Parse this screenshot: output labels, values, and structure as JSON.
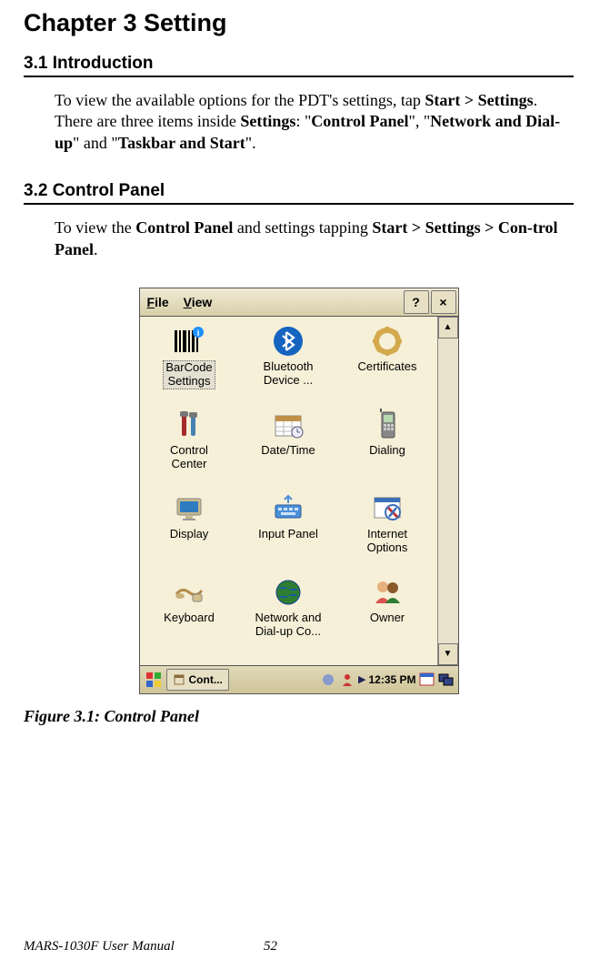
{
  "chapter": {
    "title": "Chapter 3    Setting"
  },
  "sections": [
    {
      "heading": "3.1    Introduction",
      "html": "To view the available options for the PDT's settings, tap <b>Start > Settings</b>. There are three items inside <b>Settings</b>: \"<b>Control Panel</b>\", \"<b>Network and Dial-up</b>\" and \"<b>Taskbar and Start</b>\"."
    },
    {
      "heading": "3.2    Control Panel",
      "html": "To view the <b>Control Panel</b> and settings tapping <b>Start > Settings > Con-trol Panel</b>."
    }
  ],
  "screenshot": {
    "titlebar": {
      "menu_file_u": "F",
      "menu_file_rest": "ile",
      "menu_view_u": "V",
      "menu_view_rest": "iew",
      "help": "?",
      "close": "×"
    },
    "items": [
      {
        "label": "BarCode\nSettings",
        "selected": true,
        "icon": "barcode-icon"
      },
      {
        "label": "Bluetooth\nDevice ...",
        "selected": false,
        "icon": "bluetooth-icon"
      },
      {
        "label": "Certificates",
        "selected": false,
        "icon": "gear-icon"
      },
      {
        "label": "Control\nCenter",
        "selected": false,
        "icon": "tools-icon"
      },
      {
        "label": "Date/Time",
        "selected": false,
        "icon": "calendar-icon"
      },
      {
        "label": "Dialing",
        "selected": false,
        "icon": "phone-icon"
      },
      {
        "label": "Display",
        "selected": false,
        "icon": "display-icon"
      },
      {
        "label": "Input Panel",
        "selected": false,
        "icon": "keyboard-icon"
      },
      {
        "label": "Internet\nOptions",
        "selected": false,
        "icon": "internet-icon"
      },
      {
        "label": "Keyboard",
        "selected": false,
        "icon": "keyboard2-icon"
      },
      {
        "label": "Network and\nDial-up Co...",
        "selected": false,
        "icon": "network-icon"
      },
      {
        "label": "Owner",
        "selected": false,
        "icon": "owner-icon"
      }
    ],
    "scrollbar": {
      "up": "▲",
      "down": "▼"
    },
    "taskbar": {
      "task": "Cont...",
      "time": "12:35 PM"
    }
  },
  "figure": {
    "caption": "Figure 3.1:    Control Panel"
  },
  "footer": {
    "label": "MARS-1030F User Manual",
    "page": "52"
  }
}
